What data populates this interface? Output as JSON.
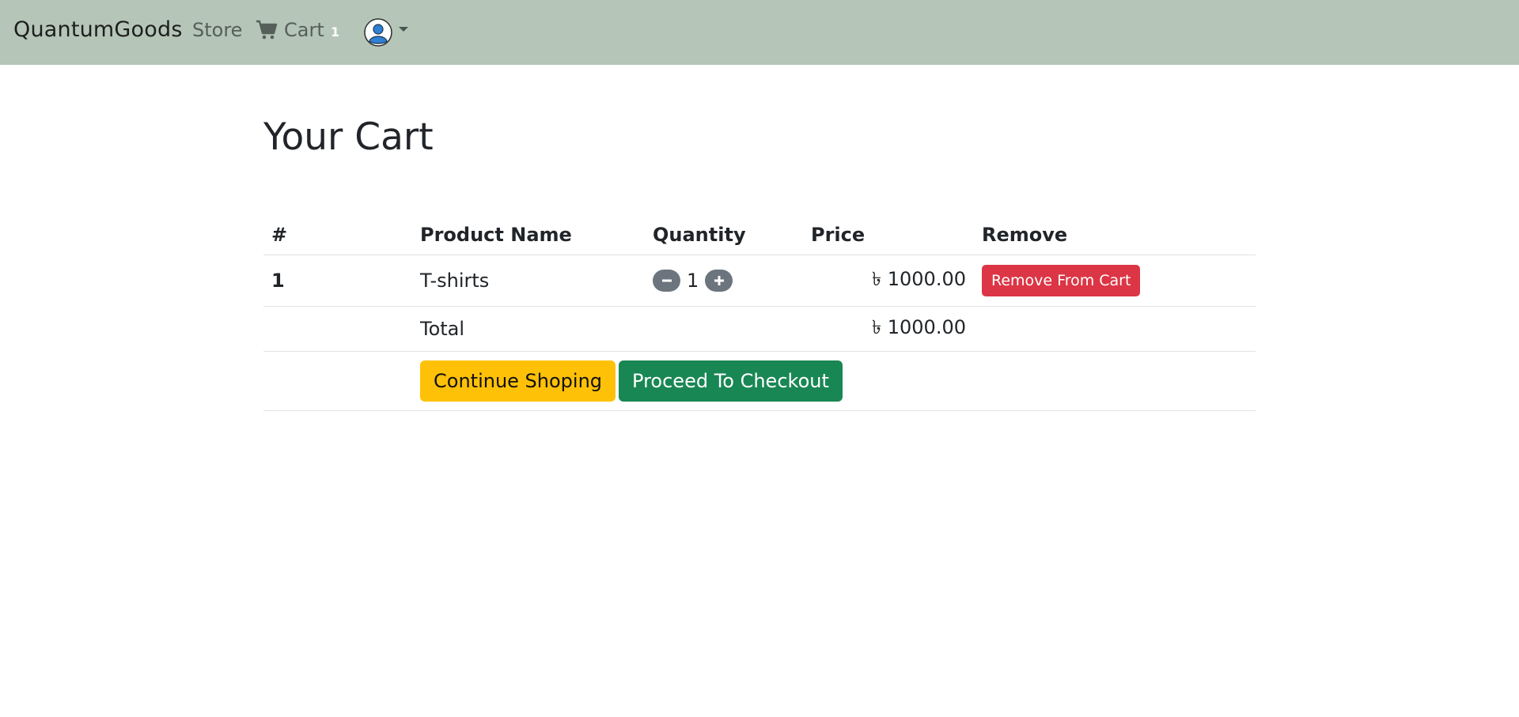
{
  "navbar": {
    "brand": "QuantumGoods",
    "store_label": "Store",
    "cart_label": "Cart",
    "cart_count": "1",
    "cart_icon": "shopping-cart-icon",
    "avatar_icon": "user-avatar-icon",
    "background_color": "#b5c5b7"
  },
  "page": {
    "title": "Your Cart"
  },
  "table": {
    "headers": [
      "#",
      "Product Name",
      "Quantity",
      "Price",
      "Remove"
    ],
    "items": [
      {
        "index": "1",
        "name": "T-shirts",
        "quantity": "1",
        "price": "৳ 1000.00",
        "remove_label": "Remove From Cart"
      }
    ],
    "total_label": "Total",
    "total_price": "৳ 1000.00"
  },
  "actions": {
    "continue_label": "Continue Shoping",
    "checkout_label": "Proceed To Checkout"
  },
  "colors": {
    "danger": "#dc3545",
    "warning": "#ffc107",
    "success": "#198754",
    "secondary": "#6c757d"
  }
}
